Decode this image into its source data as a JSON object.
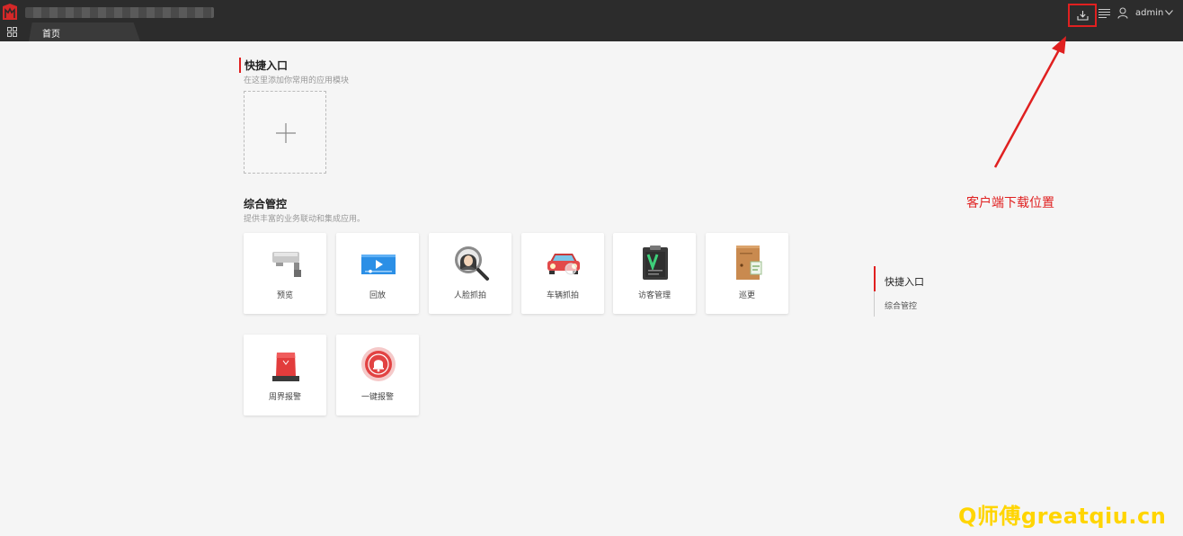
{
  "header": {
    "tab_home": "首页",
    "username": "admin"
  },
  "quick_entry": {
    "title": "快捷入口",
    "subtitle": "在这里添加你常用的应用模块"
  },
  "integrated": {
    "title": "综合管控",
    "subtitle": "提供丰富的业务联动和集成应用。",
    "cards": [
      {
        "label": "预览",
        "icon": "camera-icon"
      },
      {
        "label": "回放",
        "icon": "playback-icon"
      },
      {
        "label": "人脸抓拍",
        "icon": "face-search-icon"
      },
      {
        "label": "车辆抓拍",
        "icon": "car-icon"
      },
      {
        "label": "访客管理",
        "icon": "visitor-clipboard-icon"
      },
      {
        "label": "巡更",
        "icon": "patrol-door-icon"
      },
      {
        "label": "周界报警",
        "icon": "alarm-light-icon"
      },
      {
        "label": "一键报警",
        "icon": "alarm-bell-icon"
      }
    ]
  },
  "anchor_nav": {
    "items": [
      "快捷入口",
      "综合管控"
    ]
  },
  "annotation": {
    "text": "客户端下载位置"
  },
  "watermark": "Q师傅greatqiu.cn",
  "colors": {
    "topbar": "#2c2c2c",
    "accent_red": "#e02020",
    "watermark_yellow": "#ffd500"
  }
}
